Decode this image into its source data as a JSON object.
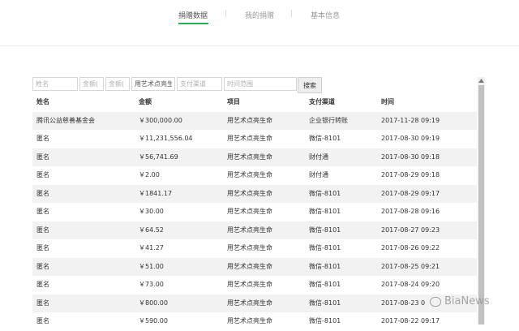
{
  "tabs": [
    {
      "label": "捐赠数据",
      "active": true
    },
    {
      "label": "我的捐赠",
      "active": false
    },
    {
      "label": "基本信息",
      "active": false
    }
  ],
  "filters": {
    "name_placeholder": "姓名",
    "amount_min_placeholder": "金额(",
    "amount_max_placeholder": "金额(",
    "project_value": "用艺术点亮生",
    "channel_placeholder": "支付渠道",
    "time_placeholder": "时间范围",
    "search_label": "搜索"
  },
  "table": {
    "headers": [
      "姓名",
      "金额",
      "项目",
      "支付渠道",
      "时间"
    ],
    "rows": [
      [
        "腾讯公益慈善基金会",
        "￥300,000.00",
        "用艺术点亮生命",
        "企业银行转账",
        "2017-11-28 09:19"
      ],
      [
        "匿名",
        "￥11,231,556.04",
        "用艺术点亮生命",
        "微信-8101",
        "2017-08-30 09:19"
      ],
      [
        "匿名",
        "￥56,741.69",
        "用艺术点亮生命",
        "财付通",
        "2017-08-30 09:18"
      ],
      [
        "匿名",
        "￥2.00",
        "用艺术点亮生命",
        "财付通",
        "2017-08-29 09:18"
      ],
      [
        "匿名",
        "￥1841.17",
        "用艺术点亮生命",
        "微信-8101",
        "2017-08-29 09:17"
      ],
      [
        "匿名",
        "￥30.00",
        "用艺术点亮生命",
        "微信-8101",
        "2017-08-28 09:16"
      ],
      [
        "匿名",
        "￥64.52",
        "用艺术点亮生命",
        "微信-8101",
        "2017-08-27 09:23"
      ],
      [
        "匿名",
        "￥41.27",
        "用艺术点亮生命",
        "微信-8101",
        "2017-08-26 09:22"
      ],
      [
        "匿名",
        "￥51.00",
        "用艺术点亮生命",
        "微信-8101",
        "2017-08-25 09:21"
      ],
      [
        "匿名",
        "￥73.00",
        "用艺术点亮生命",
        "微信-8101",
        "2017-08-24 09:20"
      ],
      [
        "匿名",
        "￥800.00",
        "用艺术点亮生命",
        "微信-8101",
        "2017-08-23 0"
      ],
      [
        "匿名",
        "￥590.00",
        "用艺术点亮生命",
        "微信-8101",
        "2017-08-22 09:17"
      ]
    ]
  },
  "watermark": "BiaNews",
  "colors": {
    "tab_underline": "#22b14c",
    "stripe": "#f2f2f2"
  }
}
